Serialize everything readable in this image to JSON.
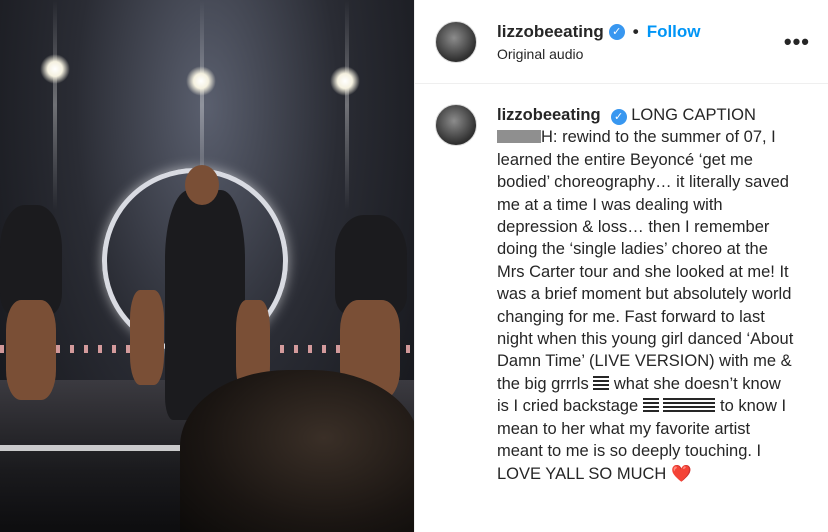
{
  "post": {
    "username": "lizzobeeating",
    "verified_icon": "verified-badge-icon",
    "separator": "•",
    "follow_label": "Follow",
    "audio_label": "Original audio",
    "more_icon": "more-options-icon",
    "more_glyph": "•••"
  },
  "caption": {
    "username": "lizzobeeating",
    "intro": "LONG CAPTION",
    "part1": "H: rewind to the summer of 07, I learned the entire Beyoncé ‘get me bodied’ choreography… it literally saved me at a time I was dealing with depression & loss… then I remember doing the ‘single ladies’ choreo at the Mrs Carter tour and she looked at me! It was a brief moment but absolutely world changing for me. Fast forward to last night when this young girl danced ‘About Damn Time’ (LIVE VERSION) with me & the big grrrls",
    "part2": "what she doesn’t know is I cried backstage",
    "part3": "to know I mean to her what my favorite artist meant to me is so deeply touching. I LOVE YALL SO MUCH",
    "heart": "❤️"
  },
  "colors": {
    "accent": "#0095f6",
    "verified": "#3897f0",
    "heart": "#e0261b"
  }
}
